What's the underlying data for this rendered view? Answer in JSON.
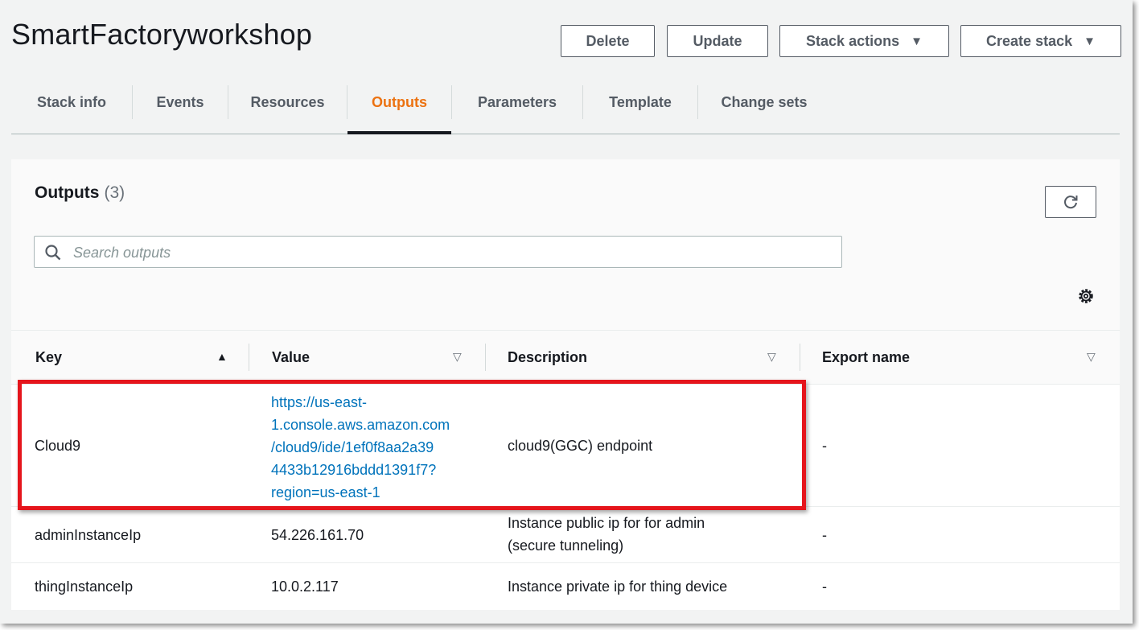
{
  "header": {
    "title": "SmartFactoryworkshop",
    "buttons": {
      "delete": "Delete",
      "update": "Update",
      "stack_actions": "Stack actions",
      "create_stack": "Create stack"
    }
  },
  "tabs": [
    {
      "label": "Stack info"
    },
    {
      "label": "Events"
    },
    {
      "label": "Resources"
    },
    {
      "label": "Outputs",
      "active": true
    },
    {
      "label": "Parameters"
    },
    {
      "label": "Template"
    },
    {
      "label": "Change sets"
    }
  ],
  "outputs_panel": {
    "title": "Outputs",
    "count": "(3)",
    "search_placeholder": "Search outputs",
    "columns": [
      "Key",
      "Value",
      "Description",
      "Export name"
    ],
    "rows": [
      {
        "key": "Cloud9",
        "value_lines": [
          "https://us-east-",
          "1.console.aws.amazon.com",
          "/cloud9/ide/1ef0f8aa2a39",
          "4433b12916bddd1391f7?",
          "region=us-east-1"
        ],
        "description_lines": [
          "cloud9(GGC) endpoint"
        ],
        "export_name": "-"
      },
      {
        "key": "adminInstanceIp",
        "value_lines": [
          "54.226.161.70"
        ],
        "description_lines": [
          "Instance public ip for for admin",
          "(secure tunneling)"
        ],
        "export_name": "-"
      },
      {
        "key": "thingInstanceIp",
        "value_lines": [
          "10.0.2.117"
        ],
        "description_lines": [
          "Instance private ip for thing device"
        ],
        "export_name": "-"
      }
    ]
  },
  "colors": {
    "active_tab": "#ec7211",
    "link": "#0073bb",
    "highlight_box": "#e5151c"
  },
  "icons": [
    "search-icon",
    "refresh-icon",
    "gear-icon",
    "sort-ascending-icon",
    "sort-descending-icon",
    "caret-down-icon"
  ]
}
